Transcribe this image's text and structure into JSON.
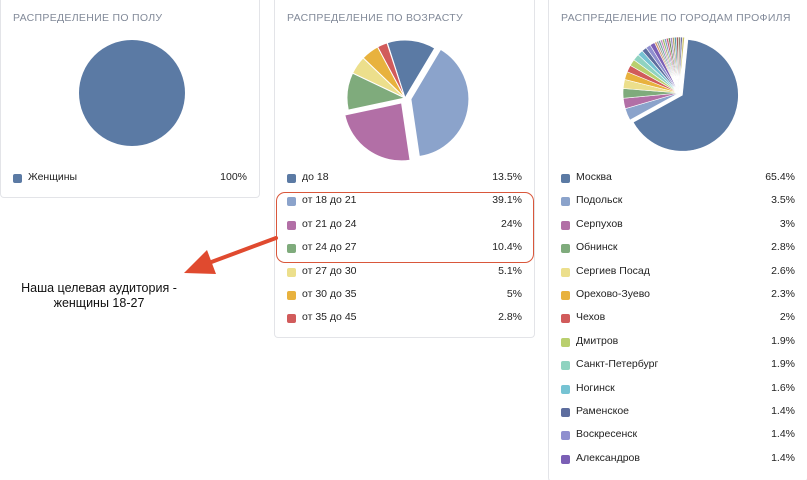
{
  "chart_data": [
    {
      "type": "pie",
      "title": "РАСПРЕДЕЛЕНИЕ ПО ПОЛУ",
      "labels": [
        "Женщины"
      ],
      "values": [
        100
      ],
      "value_labels": [
        "100%"
      ],
      "colors": [
        "#5b7aa4"
      ]
    },
    {
      "type": "pie",
      "title": "РАСПРЕДЕЛЕНИЕ ПО ВОЗРАСТУ",
      "labels": [
        "до 18",
        "от 18 до 21",
        "от 21 до 24",
        "от 24 до 27",
        "от 27 до 30",
        "от 30 до 35",
        "от 35 до 45"
      ],
      "values": [
        13.5,
        39.1,
        24,
        10.4,
        5.1,
        5,
        2.8
      ],
      "value_labels": [
        "13.5%",
        "39.1%",
        "24%",
        "10.4%",
        "5.1%",
        "5%",
        "2.8%"
      ],
      "colors": [
        "#5b7aa4",
        "#8ba3cb",
        "#b26fa6",
        "#7fab7c",
        "#ecdf8c",
        "#e8b23e",
        "#d15b5b"
      ],
      "exploded": [
        false,
        true,
        true,
        false,
        false,
        false,
        false
      ]
    },
    {
      "type": "pie",
      "title": "РАСПРЕДЕЛЕНИЕ ПО ГОРОДАМ ПРОФИЛЯ",
      "labels": [
        "Москва",
        "Подольск",
        "Серпухов",
        "Обнинск",
        "Сергиев Посад",
        "Орехово-Зуево",
        "Чехов",
        "Дмитров",
        "Санкт-Петербург",
        "Ногинск",
        "Раменское",
        "Воскресенск",
        "Александров"
      ],
      "values": [
        65.4,
        3.5,
        3,
        2.8,
        2.6,
        2.3,
        2,
        1.9,
        1.9,
        1.6,
        1.4,
        1.4,
        1.4
      ],
      "value_labels": [
        "65.4%",
        "3.5%",
        "3%",
        "2.8%",
        "2.6%",
        "2.3%",
        "2%",
        "1.9%",
        "1.9%",
        "1.6%",
        "1.4%",
        "1.4%",
        "1.4%"
      ],
      "colors": [
        "#5b7aa4",
        "#8ba3cb",
        "#b26fa6",
        "#7fab7c",
        "#ecdf8c",
        "#e8b23e",
        "#d15b5b",
        "#b9cf6e",
        "#8fd3c0",
        "#76c3d3",
        "#5d6d9e",
        "#8f8fcf",
        "#7b5fb5"
      ],
      "other_slice_colors": [
        "#d69b6e",
        "#9c9c9c",
        "#6aa6a0",
        "#c78bc0",
        "#a3b86c",
        "#7f9bc4",
        "#c95f7a",
        "#6b8f57",
        "#9e8cc7",
        "#b5a16a",
        "#5b9ea8",
        "#a65e5e",
        "#8a8a70",
        "#6f6fa0",
        "#c9c06a"
      ]
    }
  ],
  "annotation": {
    "text": "Наша целевая аудитория - женщины 18-27",
    "color": "#e04a2f"
  }
}
